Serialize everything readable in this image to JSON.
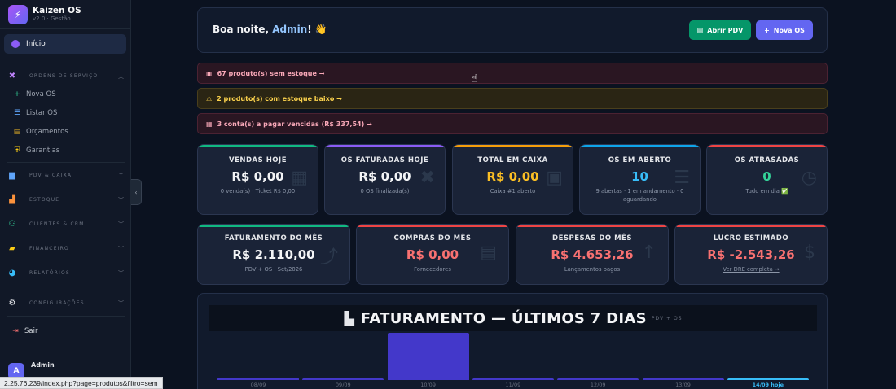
{
  "app": {
    "name": "Kaizen OS",
    "version": "v2.0 · Gestão"
  },
  "sidebar": {
    "active": "Início",
    "sections": {
      "ordens": "ORDENS DE SERVIÇO",
      "pdv": "PDV & CAIXA",
      "estoque": "ESTOQUE",
      "clientes": "CLIENTES & CRM",
      "financeiro": "FINANCEIRO",
      "relatorios": "RELATÓRIOS",
      "config": "CONFIGURAÇÕES"
    },
    "sub_items": [
      "Nova OS",
      "Listar OS",
      "Orçamentos",
      "Garantias"
    ],
    "logout": "Sair",
    "user": {
      "name": "Admin",
      "initial": "A"
    }
  },
  "header": {
    "greeting_prefix": "Boa noite, ",
    "user": "Admin",
    "greeting_suffix": "! 👋",
    "btn_pdv": "Abrir PDV",
    "btn_os": "Nova OS"
  },
  "alerts": [
    "67 produto(s) sem estoque →",
    "2 produto(s) com estoque baixo →",
    "3 conta(s) a pagar vencidas (R$ 337,54) →"
  ],
  "cards_row1": [
    {
      "title": "VENDAS HOJE",
      "value": "R$ 0,00",
      "sub": "0 venda(s) · Ticket R$ 0,00",
      "accent": "#10b981",
      "value_color": "#f3f4f6"
    },
    {
      "title": "OS FATURADAS HOJE",
      "value": "R$ 0,00",
      "sub": "0 OS finalizada(s)",
      "accent": "#8b5cf6",
      "value_color": "#f3f4f6"
    },
    {
      "title": "TOTAL EM CAIXA",
      "value": "R$ 0,00",
      "sub": "Caixa #1 aberto",
      "accent": "#f59e0b",
      "value_color": "#fbbf24"
    },
    {
      "title": "OS EM ABERTO",
      "value": "10",
      "sub": "9 abertas · 1 em andamento · 0 aguardando",
      "accent": "#0ea5e9",
      "value_color": "#38bdf8"
    },
    {
      "title": "OS ATRASADAS",
      "value": "0",
      "sub": "Tudo em dia ✅",
      "accent": "#ef4444",
      "value_color": "#34d399"
    }
  ],
  "cards_row2": [
    {
      "title": "FATURAMENTO DO MÊS",
      "value": "R$ 2.110,00",
      "sub": "PDV + OS · Set/2026",
      "accent": "#10b981",
      "value_color": "#f3f4f6"
    },
    {
      "title": "COMPRAS DO MÊS",
      "value": "R$ 0,00",
      "sub": "Fornecedores",
      "accent": "#ef4444",
      "value_color": "#f87171"
    },
    {
      "title": "DESPESAS DO MÊS",
      "value": "R$ 4.653,26",
      "sub": "Lançamentos pagos",
      "accent": "#ef4444",
      "value_color": "#f87171"
    },
    {
      "title": "LUCRO ESTIMADO",
      "value": "R$ -2.543,26",
      "sub": "Ver DRE completa →",
      "accent": "#ef4444",
      "value_color": "#f87171"
    }
  ],
  "chart_data": {
    "type": "bar",
    "title": "FATURAMENTO — ÚLTIMOS 7 DIAS",
    "tag": "PDV + OS",
    "categories": [
      "08/09",
      "09/09",
      "10/09",
      "11/09",
      "12/09",
      "13/09",
      "14/09 hoje"
    ],
    "values": [
      110,
      20,
      2000,
      20,
      20,
      20,
      20
    ]
  },
  "status_url": "2.25.76.239/index.php?page=produtos&filtro=sem"
}
